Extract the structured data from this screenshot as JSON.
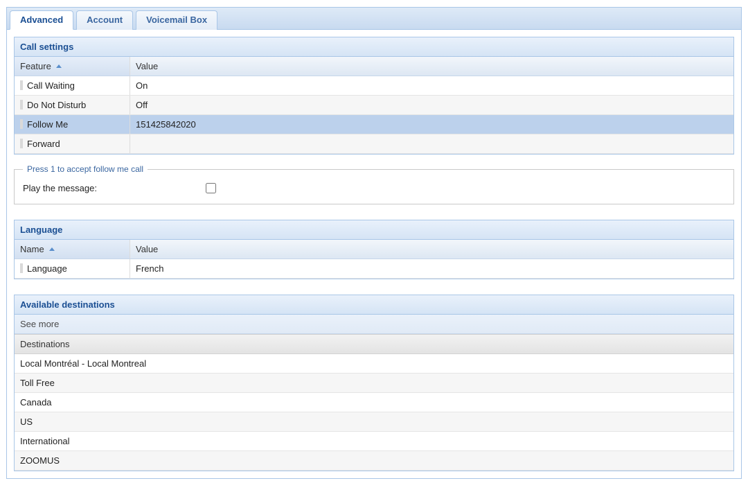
{
  "tabs": {
    "advanced": "Advanced",
    "account": "Account",
    "voicemail": "Voicemail Box"
  },
  "call_settings": {
    "title": "Call settings",
    "columns": {
      "feature": "Feature",
      "value": "Value"
    },
    "rows": [
      {
        "feature": "Call Waiting",
        "value": "On"
      },
      {
        "feature": "Do Not Disturb",
        "value": "Off"
      },
      {
        "feature": "Follow Me",
        "value": "151425842020"
      },
      {
        "feature": "Forward",
        "value": ""
      }
    ],
    "fieldset_legend": "Press 1 to accept follow me call",
    "play_message_label": "Play the message:",
    "play_message_checked": false
  },
  "language": {
    "title": "Language",
    "columns": {
      "name": "Name",
      "value": "Value"
    },
    "rows": [
      {
        "name": "Language",
        "value": "French"
      }
    ]
  },
  "destinations": {
    "title": "Available destinations",
    "see_more": "See more",
    "column_header": "Destinations",
    "rows": [
      "Local Montréal - Local Montreal",
      "Toll Free",
      "Canada",
      "US",
      "International",
      "ZOOMUS"
    ]
  }
}
